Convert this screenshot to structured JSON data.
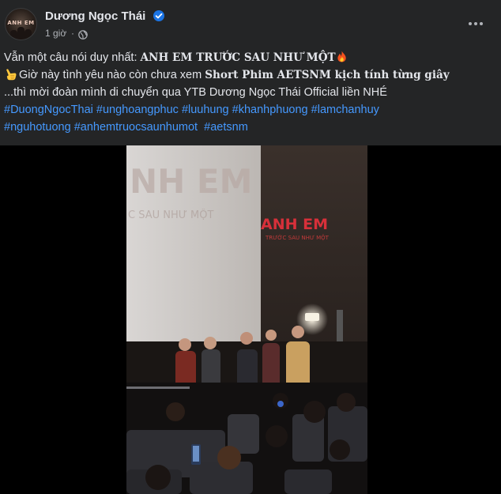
{
  "post": {
    "author": "Dương Ngọc Thái",
    "time": "1 giờ",
    "separator": "·",
    "avatar_text": "ANH EM"
  },
  "content": {
    "line1_prefix": "Vẫn một câu nói duy nhất: ",
    "line1_bold": "ANH EM TRƯỚC SAU NHƯ MỘT",
    "line2_prefix": "Giờ này tình yêu nào còn chưa xem ",
    "line2_bold": "Short Phim AETSNM kịch tính từng giây",
    "line3": "...thì mời đoàn mình di chuyển qua YTB Dương Ngọc Thái Official liền NHÉ",
    "hashtags_line1": [
      "#DuongNgocThai",
      "#unghoangphuc",
      "#luuhung",
      "#khanhphuong",
      "#lamchanhuy"
    ],
    "hashtags_line2": [
      "#nguhotuong",
      "#anhemtruocsaunhumot",
      " #aetsnm"
    ]
  },
  "video": {
    "screen_text_big": "NH EM",
    "screen_text_small": "C SAU NHƯ MỘT",
    "wall_logo": "ANH EM",
    "wall_logo_sub": "TRƯỚC SAU NHƯ MỘT"
  },
  "icons": {
    "verified": "verified-badge-icon",
    "privacy": "globe-icon",
    "more": "more-options-icon",
    "fire": "fire-emoji-icon",
    "hand": "backhand-pointing-up-emoji-icon"
  },
  "colors": {
    "background": "#242526",
    "text": "#e4e6eb",
    "secondary_text": "#b0b3b8",
    "hashtag": "#4599ff",
    "verified": "#1b74e4"
  }
}
